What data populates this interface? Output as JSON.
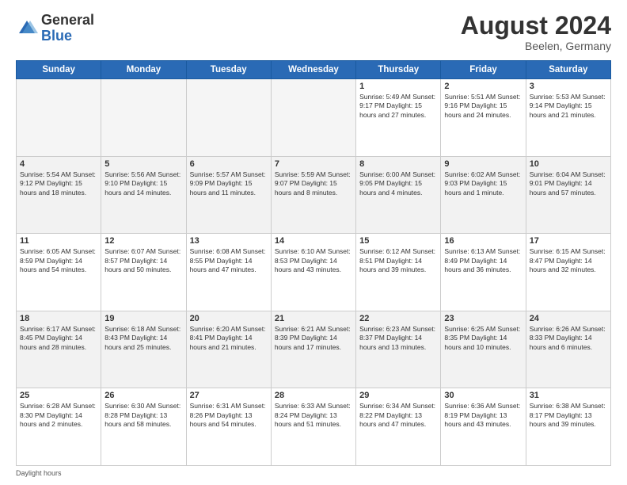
{
  "header": {
    "logo_general": "General",
    "logo_blue": "Blue",
    "month_year": "August 2024",
    "location": "Beelen, Germany"
  },
  "weekdays": [
    "Sunday",
    "Monday",
    "Tuesday",
    "Wednesday",
    "Thursday",
    "Friday",
    "Saturday"
  ],
  "footer": {
    "note": "Daylight hours"
  },
  "weeks": [
    [
      {
        "day": "",
        "info": ""
      },
      {
        "day": "",
        "info": ""
      },
      {
        "day": "",
        "info": ""
      },
      {
        "day": "",
        "info": ""
      },
      {
        "day": "1",
        "info": "Sunrise: 5:49 AM\nSunset: 9:17 PM\nDaylight: 15 hours\nand 27 minutes."
      },
      {
        "day": "2",
        "info": "Sunrise: 5:51 AM\nSunset: 9:16 PM\nDaylight: 15 hours\nand 24 minutes."
      },
      {
        "day": "3",
        "info": "Sunrise: 5:53 AM\nSunset: 9:14 PM\nDaylight: 15 hours\nand 21 minutes."
      }
    ],
    [
      {
        "day": "4",
        "info": "Sunrise: 5:54 AM\nSunset: 9:12 PM\nDaylight: 15 hours\nand 18 minutes."
      },
      {
        "day": "5",
        "info": "Sunrise: 5:56 AM\nSunset: 9:10 PM\nDaylight: 15 hours\nand 14 minutes."
      },
      {
        "day": "6",
        "info": "Sunrise: 5:57 AM\nSunset: 9:09 PM\nDaylight: 15 hours\nand 11 minutes."
      },
      {
        "day": "7",
        "info": "Sunrise: 5:59 AM\nSunset: 9:07 PM\nDaylight: 15 hours\nand 8 minutes."
      },
      {
        "day": "8",
        "info": "Sunrise: 6:00 AM\nSunset: 9:05 PM\nDaylight: 15 hours\nand 4 minutes."
      },
      {
        "day": "9",
        "info": "Sunrise: 6:02 AM\nSunset: 9:03 PM\nDaylight: 15 hours\nand 1 minute."
      },
      {
        "day": "10",
        "info": "Sunrise: 6:04 AM\nSunset: 9:01 PM\nDaylight: 14 hours\nand 57 minutes."
      }
    ],
    [
      {
        "day": "11",
        "info": "Sunrise: 6:05 AM\nSunset: 8:59 PM\nDaylight: 14 hours\nand 54 minutes."
      },
      {
        "day": "12",
        "info": "Sunrise: 6:07 AM\nSunset: 8:57 PM\nDaylight: 14 hours\nand 50 minutes."
      },
      {
        "day": "13",
        "info": "Sunrise: 6:08 AM\nSunset: 8:55 PM\nDaylight: 14 hours\nand 47 minutes."
      },
      {
        "day": "14",
        "info": "Sunrise: 6:10 AM\nSunset: 8:53 PM\nDaylight: 14 hours\nand 43 minutes."
      },
      {
        "day": "15",
        "info": "Sunrise: 6:12 AM\nSunset: 8:51 PM\nDaylight: 14 hours\nand 39 minutes."
      },
      {
        "day": "16",
        "info": "Sunrise: 6:13 AM\nSunset: 8:49 PM\nDaylight: 14 hours\nand 36 minutes."
      },
      {
        "day": "17",
        "info": "Sunrise: 6:15 AM\nSunset: 8:47 PM\nDaylight: 14 hours\nand 32 minutes."
      }
    ],
    [
      {
        "day": "18",
        "info": "Sunrise: 6:17 AM\nSunset: 8:45 PM\nDaylight: 14 hours\nand 28 minutes."
      },
      {
        "day": "19",
        "info": "Sunrise: 6:18 AM\nSunset: 8:43 PM\nDaylight: 14 hours\nand 25 minutes."
      },
      {
        "day": "20",
        "info": "Sunrise: 6:20 AM\nSunset: 8:41 PM\nDaylight: 14 hours\nand 21 minutes."
      },
      {
        "day": "21",
        "info": "Sunrise: 6:21 AM\nSunset: 8:39 PM\nDaylight: 14 hours\nand 17 minutes."
      },
      {
        "day": "22",
        "info": "Sunrise: 6:23 AM\nSunset: 8:37 PM\nDaylight: 14 hours\nand 13 minutes."
      },
      {
        "day": "23",
        "info": "Sunrise: 6:25 AM\nSunset: 8:35 PM\nDaylight: 14 hours\nand 10 minutes."
      },
      {
        "day": "24",
        "info": "Sunrise: 6:26 AM\nSunset: 8:33 PM\nDaylight: 14 hours\nand 6 minutes."
      }
    ],
    [
      {
        "day": "25",
        "info": "Sunrise: 6:28 AM\nSunset: 8:30 PM\nDaylight: 14 hours\nand 2 minutes."
      },
      {
        "day": "26",
        "info": "Sunrise: 6:30 AM\nSunset: 8:28 PM\nDaylight: 13 hours\nand 58 minutes."
      },
      {
        "day": "27",
        "info": "Sunrise: 6:31 AM\nSunset: 8:26 PM\nDaylight: 13 hours\nand 54 minutes."
      },
      {
        "day": "28",
        "info": "Sunrise: 6:33 AM\nSunset: 8:24 PM\nDaylight: 13 hours\nand 51 minutes."
      },
      {
        "day": "29",
        "info": "Sunrise: 6:34 AM\nSunset: 8:22 PM\nDaylight: 13 hours\nand 47 minutes."
      },
      {
        "day": "30",
        "info": "Sunrise: 6:36 AM\nSunset: 8:19 PM\nDaylight: 13 hours\nand 43 minutes."
      },
      {
        "day": "31",
        "info": "Sunrise: 6:38 AM\nSunset: 8:17 PM\nDaylight: 13 hours\nand 39 minutes."
      }
    ]
  ]
}
